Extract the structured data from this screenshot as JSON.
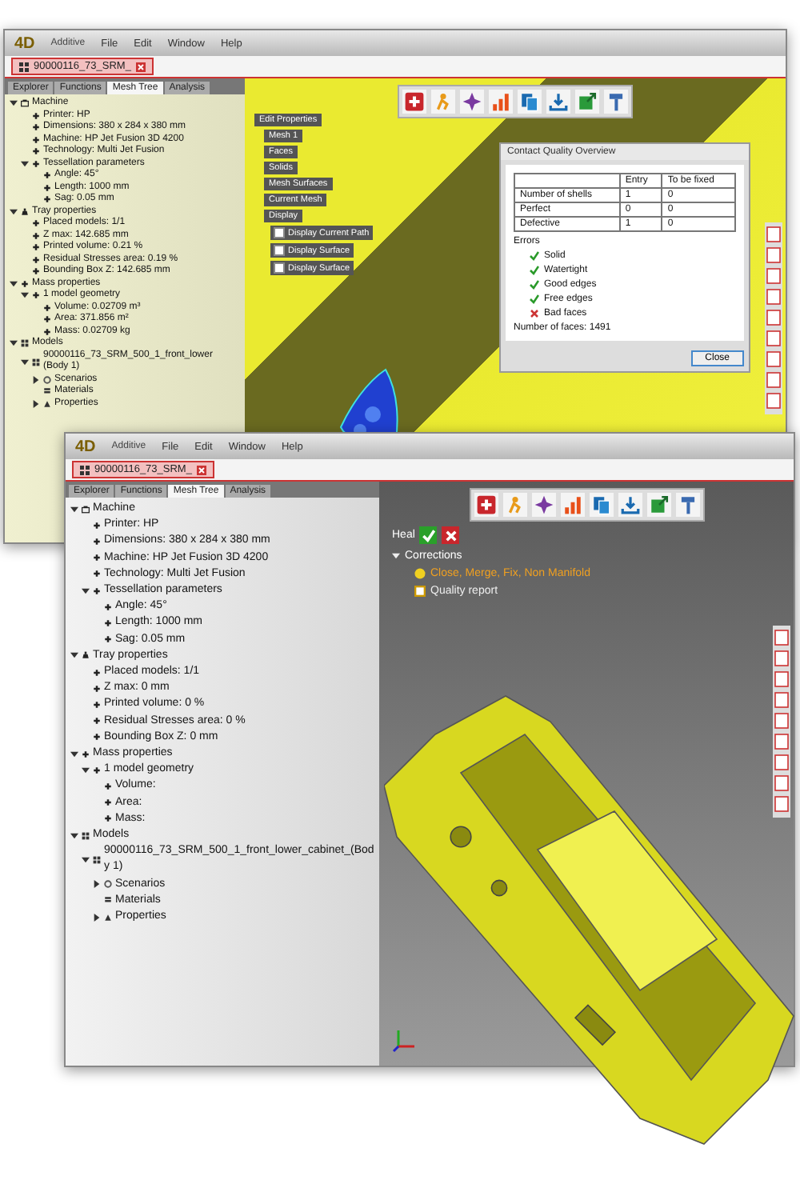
{
  "back_window": {
    "logo": "4D",
    "app_name": "Additive",
    "menu": [
      "File",
      "Edit",
      "Window",
      "Help"
    ],
    "doc_tab": "90000116_73_SRM_",
    "panel_tabs": [
      {
        "label": "Explorer",
        "selected": false
      },
      {
        "label": "Functions",
        "selected": false
      },
      {
        "label": "Mesh Tree",
        "selected": true
      },
      {
        "label": "Analysis",
        "selected": false
      }
    ],
    "tree": [
      {
        "label": "Machine",
        "kind": "machine",
        "expanded": true,
        "children": [
          {
            "label": "Printer: HP",
            "kind": "bullet"
          },
          {
            "label": "Dimensions: 380 x 284 x 380 mm",
            "kind": "bullet"
          },
          {
            "label": "Machine: HP Jet Fusion 3D 4200",
            "kind": "bullet"
          },
          {
            "label": "Technology: Multi Jet Fusion",
            "kind": "bullet"
          },
          {
            "label": "Tessellation parameters",
            "kind": "bullet",
            "expanded": true,
            "children": [
              {
                "label": "Angle: 45°",
                "kind": "bullet"
              },
              {
                "label": "Length: 1000 mm",
                "kind": "bullet"
              },
              {
                "label": "Sag: 0.05 mm",
                "kind": "bullet"
              }
            ]
          }
        ]
      },
      {
        "label": "Tray properties",
        "kind": "tray",
        "expanded": true,
        "children": [
          {
            "label": "Placed models: 1/1",
            "kind": "bullet"
          },
          {
            "label": "Z max: 142.685 mm",
            "kind": "bullet"
          },
          {
            "label": "Printed volume: 0.21 %",
            "kind": "bullet"
          },
          {
            "label": "Residual Stresses area: 0.19 %",
            "kind": "bullet"
          },
          {
            "label": "Bounding Box Z: 142.685 mm",
            "kind": "bullet"
          }
        ]
      },
      {
        "label": "Mass properties",
        "kind": "bullet",
        "expanded": true,
        "children": [
          {
            "label": "1 model geometry",
            "kind": "bullet",
            "expanded": true,
            "children": [
              {
                "label": "Volume: 0.02709 m³",
                "kind": "bullet"
              },
              {
                "label": "Area: 371.856 m²",
                "kind": "bullet"
              },
              {
                "label": "Mass: 0.02709 kg",
                "kind": "bullet"
              }
            ]
          }
        ]
      },
      {
        "label": "Models",
        "kind": "models",
        "expanded": true,
        "children": [
          {
            "label": "90000116_73_SRM_500_1_front_lower (Body 1)",
            "kind": "models",
            "expanded": true,
            "children": [
              {
                "label": "Scenarios",
                "kind": "scenario",
                "expanded": false
              },
              {
                "label": "Materials",
                "kind": "material"
              },
              {
                "label": "Properties",
                "kind": "properties",
                "expanded": false
              }
            ]
          }
        ]
      }
    ],
    "toolbar": [
      {
        "kind": "plus"
      },
      {
        "kind": "figure"
      },
      {
        "kind": "star"
      },
      {
        "kind": "bars"
      },
      {
        "kind": "copy"
      },
      {
        "kind": "download"
      },
      {
        "kind": "export"
      },
      {
        "kind": "hammer"
      }
    ],
    "props_panel": {
      "title": "Edit Properties",
      "items": [
        "Mesh 1",
        "Faces",
        "Solids",
        "Mesh Surfaces",
        "Current Mesh",
        "Display"
      ],
      "checks": [
        {
          "label": "Display Current Path",
          "checked": false
        },
        {
          "label": "Display Surface",
          "checked": false
        },
        {
          "label": "Display Surface",
          "checked": false
        }
      ]
    },
    "dialog": {
      "title": "Contact Quality Overview",
      "columns": [
        "",
        "Entry",
        "To be fixed"
      ],
      "rows": [
        [
          "Number of shells",
          "1",
          "0"
        ],
        [
          "Perfect",
          "0",
          "0"
        ],
        [
          "Defective",
          "1",
          "0"
        ]
      ],
      "errors_title": "Errors",
      "checks": [
        {
          "label": "Solid",
          "passed": true
        },
        {
          "label": "Watertight",
          "passed": true
        },
        {
          "label": "Good edges",
          "passed": true
        },
        {
          "label": "Free edges",
          "passed": true
        },
        {
          "label": "Bad faces",
          "passed": false
        }
      ],
      "faces": "Number of faces: 1491",
      "button": "Close"
    }
  },
  "front_window": {
    "logo": "4D",
    "app_name": "Additive",
    "menu": [
      "File",
      "Edit",
      "Window",
      "Help"
    ],
    "doc_tab": "90000116_73_SRM_",
    "panel_tabs": [
      {
        "label": "Explorer",
        "selected": false
      },
      {
        "label": "Functions",
        "selected": false
      },
      {
        "label": "Mesh Tree",
        "selected": true
      },
      {
        "label": "Analysis",
        "selected": false
      }
    ],
    "tree": [
      {
        "label": "Machine",
        "kind": "machine",
        "expanded": true,
        "children": [
          {
            "label": "Printer: HP",
            "kind": "bullet"
          },
          {
            "label": "Dimensions: 380 x 284 x 380 mm",
            "kind": "bullet"
          },
          {
            "label": "Machine: HP Jet Fusion 3D 4200",
            "kind": "bullet"
          },
          {
            "label": "Technology: Multi Jet Fusion",
            "kind": "bullet"
          },
          {
            "label": "Tessellation parameters",
            "kind": "bullet",
            "expanded": true,
            "children": [
              {
                "label": "Angle: 45°",
                "kind": "bullet"
              },
              {
                "label": "Length: 1000 mm",
                "kind": "bullet"
              },
              {
                "label": "Sag: 0.05 mm",
                "kind": "bullet"
              }
            ]
          }
        ]
      },
      {
        "label": "Tray properties",
        "kind": "tray",
        "expanded": true,
        "children": [
          {
            "label": "Placed models: 1/1",
            "kind": "bullet"
          },
          {
            "label": "Z max: 0 mm",
            "kind": "bullet"
          },
          {
            "label": "Printed volume: 0 %",
            "kind": "bullet"
          },
          {
            "label": "Residual Stresses area: 0 %",
            "kind": "bullet"
          },
          {
            "label": "Bounding Box Z: 0 mm",
            "kind": "bullet"
          }
        ]
      },
      {
        "label": "Mass properties",
        "kind": "bullet",
        "expanded": true,
        "children": [
          {
            "label": "1 model geometry",
            "kind": "bullet",
            "expanded": true,
            "children": [
              {
                "label": "Volume:",
                "kind": "bullet"
              },
              {
                "label": "Area:",
                "kind": "bullet"
              },
              {
                "label": "Mass:",
                "kind": "bullet"
              }
            ]
          }
        ]
      },
      {
        "label": "Models",
        "kind": "models",
        "expanded": true,
        "children": [
          {
            "label": "90000116_73_SRM_500_1_front_lower_cabinet_(Body 1)",
            "kind": "models",
            "expanded": true,
            "children": [
              {
                "label": "Scenarios",
                "kind": "scenario",
                "expanded": false
              },
              {
                "label": "Materials",
                "kind": "material"
              },
              {
                "label": "Properties",
                "kind": "properties",
                "expanded": false
              }
            ]
          }
        ]
      }
    ],
    "toolbar": [
      {
        "kind": "plus"
      },
      {
        "kind": "figure"
      },
      {
        "kind": "star"
      },
      {
        "kind": "bars"
      },
      {
        "kind": "copy"
      },
      {
        "kind": "download"
      },
      {
        "kind": "export"
      },
      {
        "kind": "hammer"
      }
    ],
    "heal": {
      "label": "Heal",
      "node": "Corrections",
      "expanded": true,
      "items": [
        {
          "label": "Close, Merge, Fix, Non Manifold",
          "kind": "warning"
        },
        {
          "label": "Quality report",
          "kind": "report"
        }
      ]
    }
  }
}
